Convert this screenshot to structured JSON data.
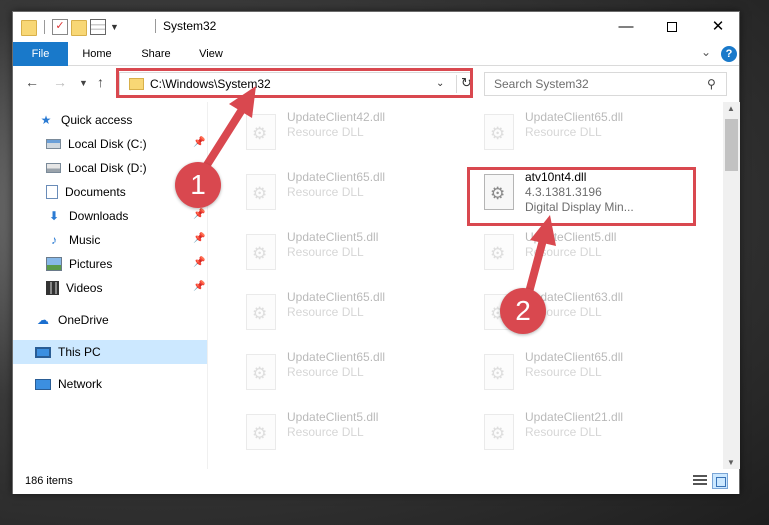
{
  "window": {
    "title": "System32",
    "minimize_glyph": "—",
    "close_glyph": "✕"
  },
  "ribbon": {
    "tabs": [
      "File",
      "Home",
      "Share",
      "View"
    ],
    "help_glyph": "?"
  },
  "navbar": {
    "address": "C:\\Windows\\System32",
    "search_placeholder": "Search System32"
  },
  "sidebar": {
    "items": [
      {
        "label": "Quick access",
        "icon": "star-icon"
      },
      {
        "label": "Local Disk (C:)",
        "icon": "drive-icon",
        "pinned": true
      },
      {
        "label": "Local Disk (D:)",
        "icon": "drive-icon"
      },
      {
        "label": "Documents",
        "icon": "documents-icon",
        "pinned": true
      },
      {
        "label": "Downloads",
        "icon": "downloads-icon",
        "pinned": true
      },
      {
        "label": "Music",
        "icon": "music-icon",
        "pinned": true
      },
      {
        "label": "Pictures",
        "icon": "pictures-icon",
        "pinned": true
      },
      {
        "label": "Videos",
        "icon": "videos-icon",
        "pinned": true
      },
      {
        "label": "OneDrive",
        "icon": "onedrive-icon"
      },
      {
        "label": "This PC",
        "icon": "this-pc-icon",
        "selected": true
      },
      {
        "label": "Network",
        "icon": "network-icon"
      }
    ]
  },
  "files": [
    {
      "name": "UpdateClient42.dll",
      "type": "Resource DLL"
    },
    {
      "name": "UpdateClient65.dll",
      "type": "Resource DLL"
    },
    {
      "name": "UpdateClient65.dll",
      "type": "Resource DLL"
    },
    {
      "name": "atv10nt4.dll",
      "type": "4.3.1381.3196",
      "desc": "Digital Display Min..."
    },
    {
      "name": "UpdateClient5.dll",
      "type": "Resource DLL"
    },
    {
      "name": "UpdateClient5.dll",
      "type": "Resource DLL"
    },
    {
      "name": "UpdateClient65.dll",
      "type": "Resource DLL"
    },
    {
      "name": "UpdateClient63.dll",
      "type": "Resource DLL"
    },
    {
      "name": "UpdateClient65.dll",
      "type": "Resource DLL"
    },
    {
      "name": "UpdateClient65.dll",
      "type": "Resource DLL"
    },
    {
      "name": "UpdateClient5.dll",
      "type": "Resource DLL"
    },
    {
      "name": "UpdateClient21.dll",
      "type": "Resource DLL"
    }
  ],
  "status": {
    "item_count": "186 items"
  },
  "annotations": {
    "badge1": "1",
    "badge2": "2",
    "color": "#d9484f"
  }
}
